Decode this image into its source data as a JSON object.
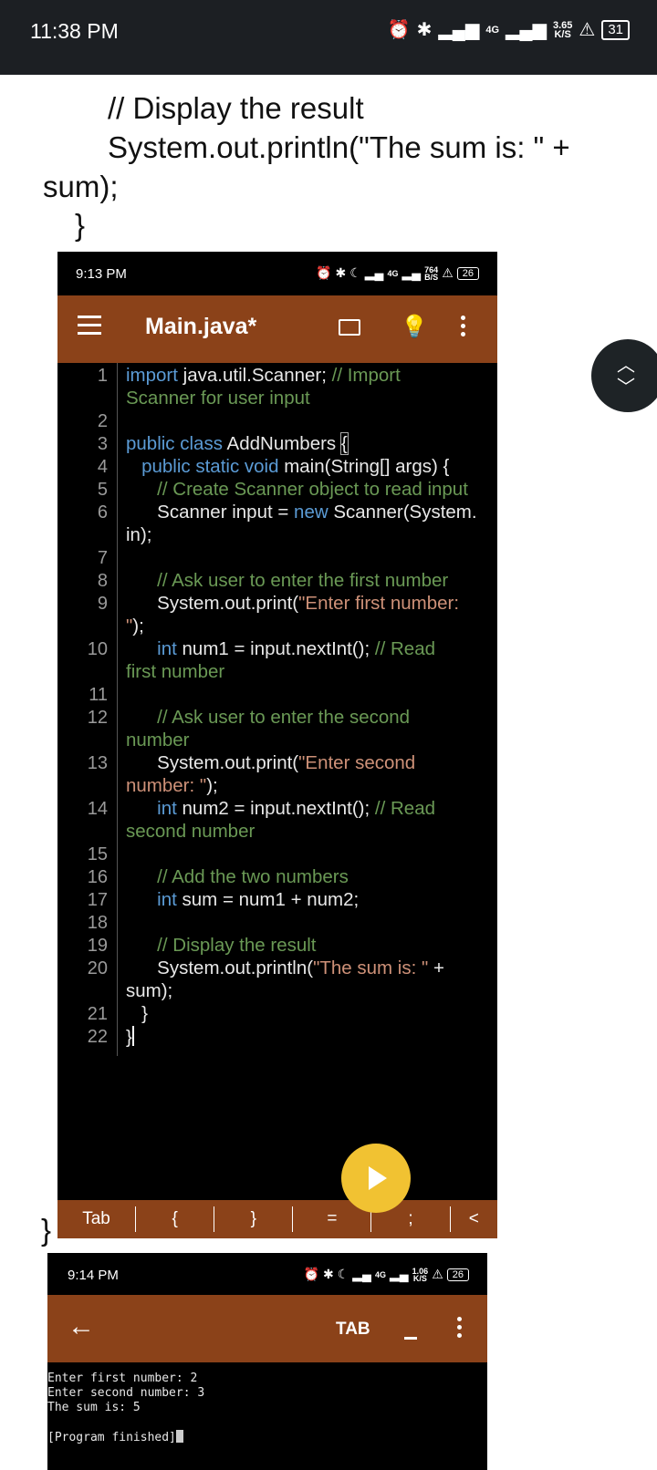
{
  "outer_status": {
    "time": "11:38 PM",
    "net_type": "4G",
    "speed_value": "3.65",
    "speed_unit": "K/S",
    "battery": "31"
  },
  "document_lines": [
    "// Display the result",
    "System.out.println(\"The sum is: \" +",
    "sum);",
    "}"
  ],
  "closing_brace": "}",
  "editor_screen": {
    "status": {
      "time": "9:13 PM",
      "net_type": "4G",
      "speed_value": "764",
      "speed_unit": "B/S",
      "battery": "26"
    },
    "file_title": "Main.java*",
    "line_numbers": [
      "1",
      "2",
      "3",
      "4",
      "5",
      "6",
      "7",
      "8",
      "9",
      "10",
      "11",
      "12",
      "13",
      "14",
      "15",
      "16",
      "17",
      "18",
      "19",
      "20",
      "21",
      "22"
    ],
    "code": {
      "l1a": "import",
      "l1b": " java.util.Scanner; ",
      "l1c": "// Import",
      "l1d": "Scanner for user input",
      "l3a": "public class",
      "l3b": " AddNumbers ",
      "l3c": "{",
      "l4a": "   public static void",
      "l4b": " main(String[] args) {",
      "l5": "      // Create Scanner object to read input",
      "l6a": "      Scanner input = ",
      "l6b": "new",
      "l6c": " Scanner(System.",
      "l6d": "in);",
      "l8": "      // Ask user to enter the first number",
      "l9a": "      System.out.print(",
      "l9b": "\"Enter first number:",
      "l9c": "\"",
      "l9d": ");",
      "l10a": "      int",
      "l10b": " num1 = input.nextInt(); ",
      "l10c": "// Read",
      "l10d": "first number",
      "l12a": "      // Ask user to enter the second",
      "l12b": "number",
      "l13a": "      System.out.print(",
      "l13b": "\"Enter second",
      "l13c": "number: \"",
      "l13d": ");",
      "l14a": "      int",
      "l14b": " num2 = input.nextInt(); ",
      "l14c": "// Read",
      "l14d": "second number",
      "l16": "      // Add the two numbers",
      "l17a": "      int",
      "l17b": " sum = num1 + num2;",
      "l19": "      // Display the result",
      "l20a": "      System.out.println(",
      "l20b": "\"The sum is: \"",
      "l20c": " +",
      "l20d": "sum);",
      "l21": "   }",
      "l22": "}"
    },
    "extra_keys": [
      "Tab",
      "{",
      "}",
      "=",
      ";",
      "<"
    ]
  },
  "terminal_screen": {
    "status": {
      "time": "9:14 PM",
      "net_type": "4G",
      "speed_value": "1.06",
      "speed_unit": "K/S",
      "battery": "26"
    },
    "tab_label": "TAB",
    "output_lines": [
      "Enter first number: 2",
      "Enter second number: 3",
      "The sum is: 5",
      "",
      "[Program finished]"
    ]
  },
  "icons": {
    "alarm": "alarm-icon",
    "bluetooth": "bluetooth-icon",
    "moon": "moon-icon",
    "signal": "signal-icon",
    "menu": "menu-icon",
    "folder": "folder-icon",
    "bulb": "lightbulb-icon",
    "more": "more-vert-icon",
    "back": "back-arrow-icon",
    "run": "play-icon"
  },
  "colors": {
    "app_bar": "#8b4219",
    "run_button": "#f1c232",
    "keyword": "#5b9bd5",
    "comment": "#6a9955",
    "string": "#ce9178"
  }
}
